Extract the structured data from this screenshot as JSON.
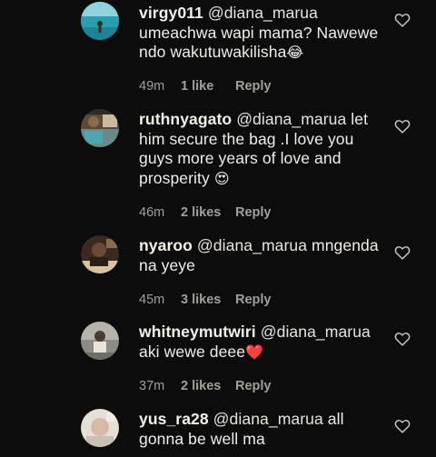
{
  "comments": [
    {
      "username": "virgy011",
      "mention": "@diana_marua",
      "text": "umeachwa wapi mama? Nawewe ndo wakutuwakilisha",
      "emoji": "😂",
      "time": "49m",
      "likes": "1 like",
      "reply": "Reply",
      "avatar_icon": "beach-avatar-icon"
    },
    {
      "username": "ruthnyagato",
      "mention": "@diana_marua",
      "text": "let him secure the bag .I love you guys more years of love and prosperity",
      "emoji": "😍",
      "time": "46m",
      "likes": "2 likes",
      "reply": "Reply",
      "avatar_icon": "pool-avatar-icon"
    },
    {
      "username": "nyaroo",
      "mention": "@diana_marua",
      "text": "mngenda na yeye",
      "emoji": "",
      "time": "45m",
      "likes": "3 likes",
      "reply": "Reply",
      "avatar_icon": "portrait-avatar-icon"
    },
    {
      "username": "whitneymutwiri",
      "mention": "@diana_marua",
      "text": "aki wewe deee",
      "emoji": "❤️",
      "time": "37m",
      "likes": "2 likes",
      "reply": "Reply",
      "avatar_icon": "person-avatar-icon"
    },
    {
      "username": "yus_ra28",
      "mention": "@diana_marua",
      "text": "all gonna be well ma",
      "emoji": "",
      "time": "",
      "likes": "",
      "reply": "",
      "avatar_icon": "light-avatar-icon"
    }
  ],
  "like_icon": "heart-outline-icon",
  "colors": {
    "background": "#0c0c0c",
    "text": "#f2ede6",
    "meta": "#a39f99"
  }
}
